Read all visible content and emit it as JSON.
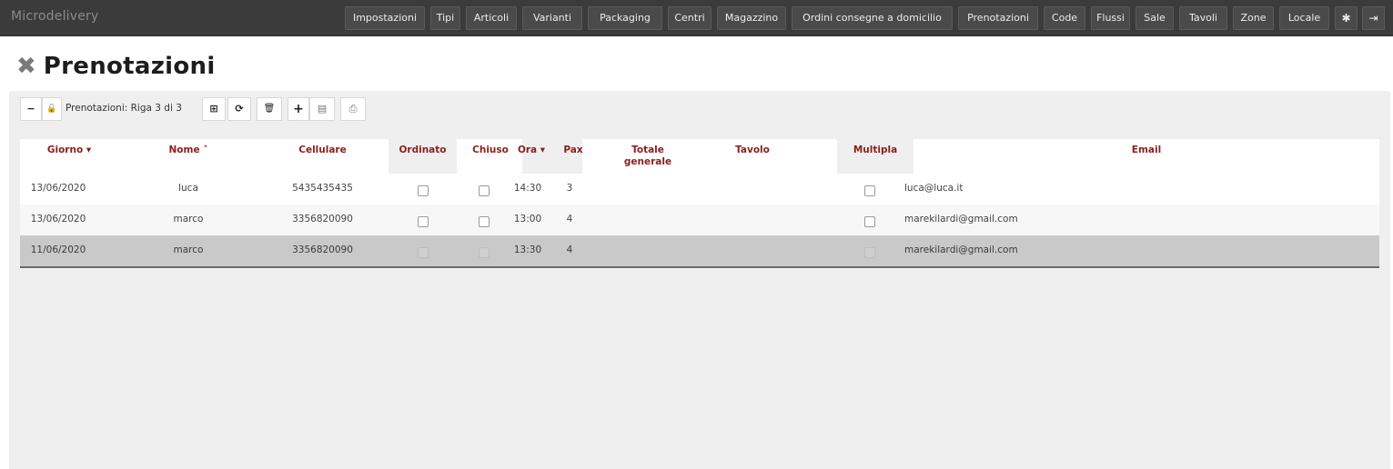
{
  "app": {
    "brand": "Microdelivery"
  },
  "nav": {
    "items": [
      "Impostazioni",
      "Tipi",
      "Articoli",
      "Varianti",
      "Packaging",
      "Centri",
      "Magazzino",
      "Ordini consegne a domicilio",
      "Prenotazioni",
      "Code",
      "Flussi",
      "Sale",
      "Tavoli",
      "Zone",
      "Locale"
    ],
    "bug_icon": "✱",
    "logout_icon": "⇥"
  },
  "page": {
    "close_icon": "✖",
    "title": "Prenotazioni"
  },
  "toolbar": {
    "collapse_icon": "−",
    "lock_icon": "🔓",
    "record_info": "Prenotazioni: Riga 3 di 3",
    "columns_icon": "⊞",
    "refresh_icon": "⟳",
    "delete_icon": "🗑",
    "add_icon": "+",
    "save_icon": "▤",
    "export_icon": "⎙"
  },
  "table": {
    "headers": {
      "giorno": "Giorno ▾",
      "nome": "Nome ˄",
      "cellulare": "Cellulare",
      "ordinato": "Ordinato",
      "chiuso": "Chiuso",
      "ora": "Ora ▾",
      "pax": "Pax",
      "totale_l1": "Totale",
      "totale_l2": "generale",
      "tavolo": "Tavolo",
      "multipla": "Multipla",
      "email": "Email"
    },
    "rows": [
      {
        "giorno": "13/06/2020",
        "nome": "luca",
        "cellulare": "5435435435",
        "ordinato": false,
        "chiuso": false,
        "ora": "14:30",
        "pax": "3",
        "totale": "",
        "tavolo": "",
        "multipla": false,
        "email": "luca@luca.it"
      },
      {
        "giorno": "13/06/2020",
        "nome": "marco",
        "cellulare": "3356820090",
        "ordinato": false,
        "chiuso": false,
        "ora": "13:00",
        "pax": "4",
        "totale": "",
        "tavolo": "",
        "multipla": false,
        "email": "marekilardi@gmail.com"
      },
      {
        "giorno": "11/06/2020",
        "nome": "marco",
        "cellulare": "3356820090",
        "ordinato": false,
        "chiuso": false,
        "ora": "13:30",
        "pax": "4",
        "totale": "",
        "tavolo": "",
        "multipla": false,
        "email": "marekilardi@gmail.com"
      }
    ]
  }
}
